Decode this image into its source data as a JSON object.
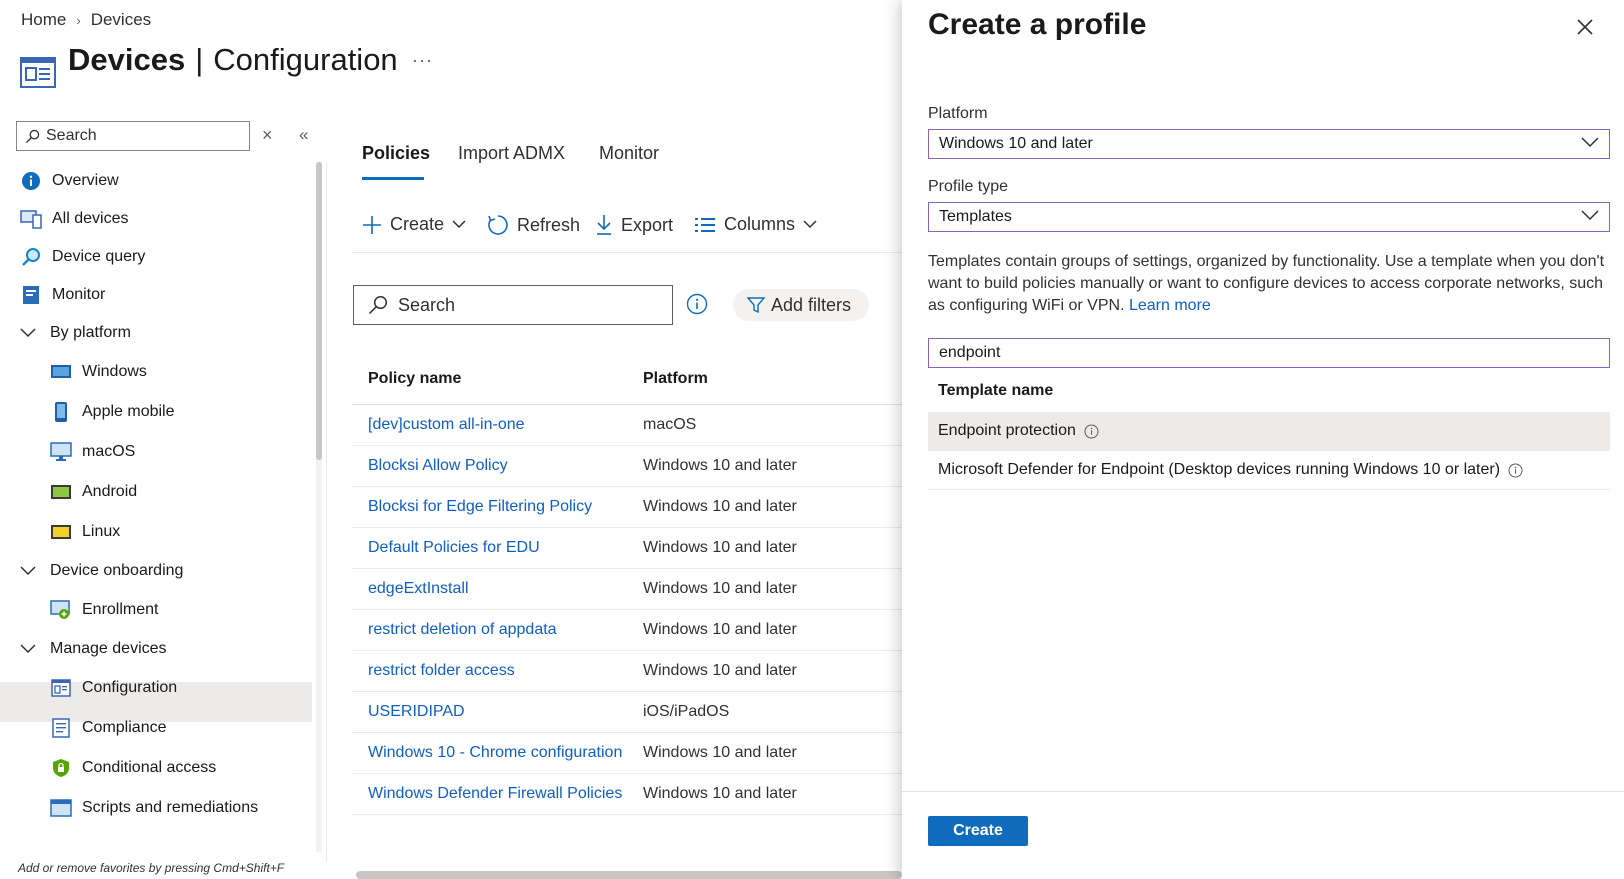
{
  "breadcrumb": {
    "home": "Home",
    "current": "Devices"
  },
  "page": {
    "title_bold": "Devices",
    "title_rest": "Configuration",
    "more": "···"
  },
  "sidebar": {
    "search_placeholder": "Search",
    "items": [
      {
        "label": "Overview",
        "icon": "info-icon"
      },
      {
        "label": "All devices",
        "icon": "devices-icon"
      },
      {
        "label": "Device query",
        "icon": "query-icon"
      },
      {
        "label": "Monitor",
        "icon": "monitor-icon"
      }
    ],
    "group_platform": "By platform",
    "platform_items": [
      {
        "label": "Windows",
        "icon": "windows-icon"
      },
      {
        "label": "Apple mobile",
        "icon": "phone-icon"
      },
      {
        "label": "macOS",
        "icon": "mac-icon"
      },
      {
        "label": "Android",
        "icon": "android-icon"
      },
      {
        "label": "Linux",
        "icon": "linux-icon"
      }
    ],
    "group_onboarding": "Device onboarding",
    "onboarding_items": [
      {
        "label": "Enrollment",
        "icon": "enrollment-icon"
      }
    ],
    "group_manage": "Manage devices",
    "manage_items": [
      {
        "label": "Configuration",
        "icon": "configuration-icon"
      },
      {
        "label": "Compliance",
        "icon": "compliance-icon"
      },
      {
        "label": "Conditional access",
        "icon": "shield-icon"
      },
      {
        "label": "Scripts and remediations",
        "icon": "scripts-icon"
      }
    ],
    "favorites_hint": "Add or remove favorites by pressing Cmd+Shift+F"
  },
  "tabs": [
    "Policies",
    "Import ADMX",
    "Monitor"
  ],
  "toolbar": {
    "create": "Create",
    "refresh": "Refresh",
    "export": "Export",
    "columns": "Columns"
  },
  "main": {
    "search_placeholder": "Search",
    "add_filters": "Add filters",
    "col_policy": "Policy name",
    "col_platform": "Platform",
    "rows": [
      {
        "name": "[dev]custom all-in-one",
        "platform": "macOS"
      },
      {
        "name": "Blocksi Allow Policy",
        "platform": "Windows 10 and later"
      },
      {
        "name": "Blocksi for Edge Filtering Policy",
        "platform": "Windows 10 and later"
      },
      {
        "name": "Default Policies for EDU",
        "platform": "Windows 10 and later"
      },
      {
        "name": "edgeExtInstall",
        "platform": "Windows 10 and later"
      },
      {
        "name": "restrict deletion of appdata",
        "platform": "Windows 10 and later"
      },
      {
        "name": "restrict folder access",
        "platform": "Windows 10 and later"
      },
      {
        "name": "USERIDIPAD",
        "platform": "iOS/iPadOS"
      },
      {
        "name": "Windows 10 - Chrome configuration",
        "platform": "Windows 10 and later"
      },
      {
        "name": "Windows Defender Firewall Policies",
        "platform": "Windows 10 and later"
      }
    ]
  },
  "panel": {
    "title": "Create a profile",
    "platform_label": "Platform",
    "platform_value": "Windows 10 and later",
    "profile_type_label": "Profile type",
    "profile_type_value": "Templates",
    "description": "Templates contain groups of settings, organized by functionality. Use a template when you don't want to build policies manually or want to configure devices to access corporate networks, such as configuring WiFi or VPN.",
    "learn_more": "Learn more",
    "filter_value": "endpoint",
    "template_head": "Template name",
    "templates": [
      "Endpoint protection",
      "Microsoft Defender for Endpoint (Desktop devices running Windows 10 or later)"
    ],
    "create_button": "Create"
  },
  "colors": {
    "accent": "#0f6cbd",
    "link": "#0f5ec4",
    "focus": "#8764b8"
  }
}
